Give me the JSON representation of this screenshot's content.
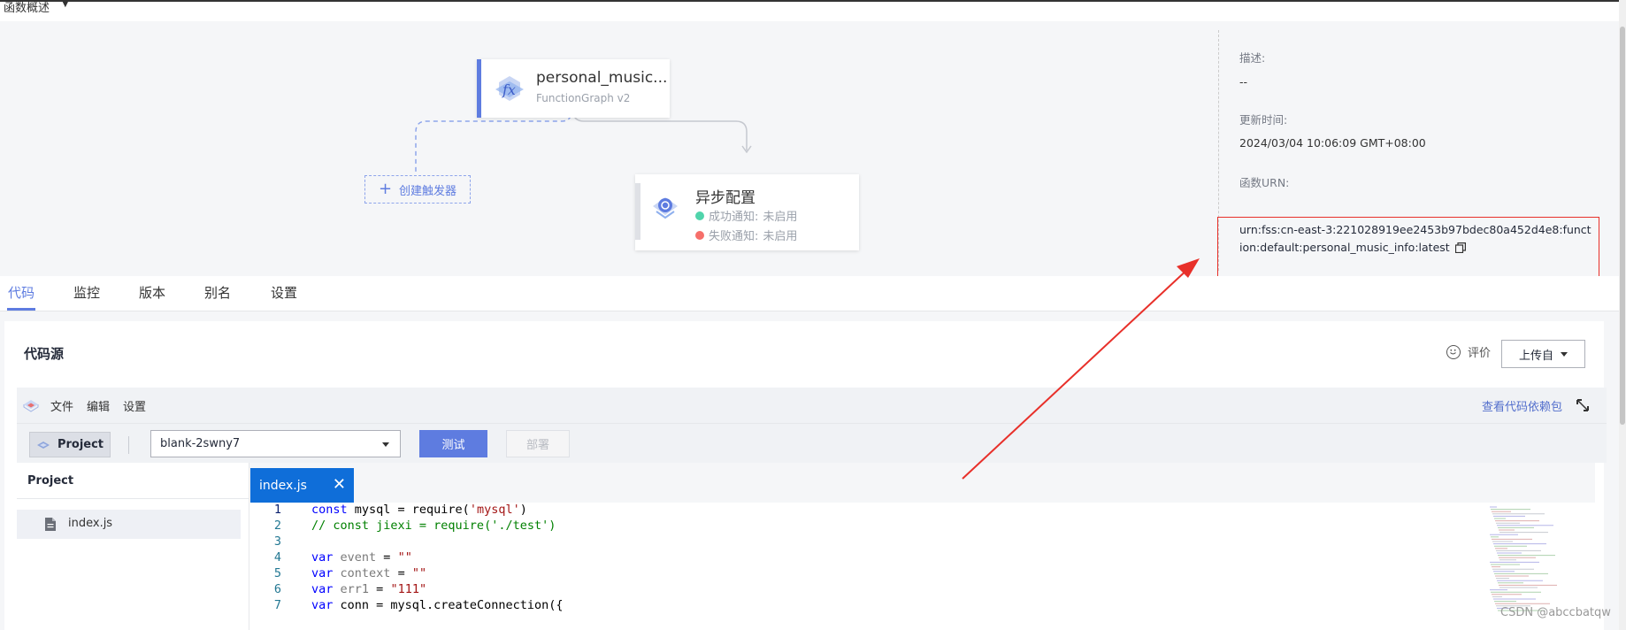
{
  "top": {
    "section_title": "函数概述"
  },
  "function_node": {
    "title": "personal_music...",
    "subtitle": "FunctionGraph v2"
  },
  "trigger": {
    "label": "创建触发器"
  },
  "async_node": {
    "title": "异步配置",
    "success_label": "成功通知:",
    "success_value": "未启用",
    "fail_label": "失败通知:",
    "fail_value": "未启用",
    "success_color": "#50d4ab",
    "fail_color": "#f66f6a"
  },
  "info": {
    "desc_label": "描述:",
    "desc_value": "--",
    "updated_label": "更新时间:",
    "updated_value": "2024/03/04 10:06:09 GMT+08:00",
    "urn_label": "函数URN:",
    "urn_value": "urn:fss:cn-east-3:221028919ee2453b97bdec80a452d4e8:function:default:personal_music_info:latest"
  },
  "tabs": [
    "代码",
    "监控",
    "版本",
    "别名",
    "设置"
  ],
  "panel": {
    "title": "代码源",
    "rate_label": "评价",
    "upload_label": "上传自"
  },
  "ide": {
    "menu": [
      "文件",
      "编辑",
      "设置"
    ],
    "dependency_link": "查看代码依赖包",
    "project_button": "Project",
    "selected_project": "blank-2swny7",
    "test_button": "测试",
    "deploy_button": "部署",
    "explorer_title": "Project",
    "file_name": "index.js",
    "tab_name": "index.js"
  },
  "code_lines": [
    {
      "n": "1",
      "text": "const mysql = require('mysql')"
    },
    {
      "n": "2",
      "text": "// const jiexi = require('./test')"
    },
    {
      "n": "3",
      "text": ""
    },
    {
      "n": "4",
      "text": "var event = \"\""
    },
    {
      "n": "5",
      "text": "var context = \"\""
    },
    {
      "n": "6",
      "text": "var err1 = \"111\""
    },
    {
      "n": "7",
      "text": "var conn = mysql.createConnection({"
    }
  ],
  "watermark": "CSDN @abccbatqw",
  "colors": {
    "accent": "#5e7ce0",
    "highlight_border": "#e8302a",
    "annotation_arrow": "#e8302a"
  }
}
